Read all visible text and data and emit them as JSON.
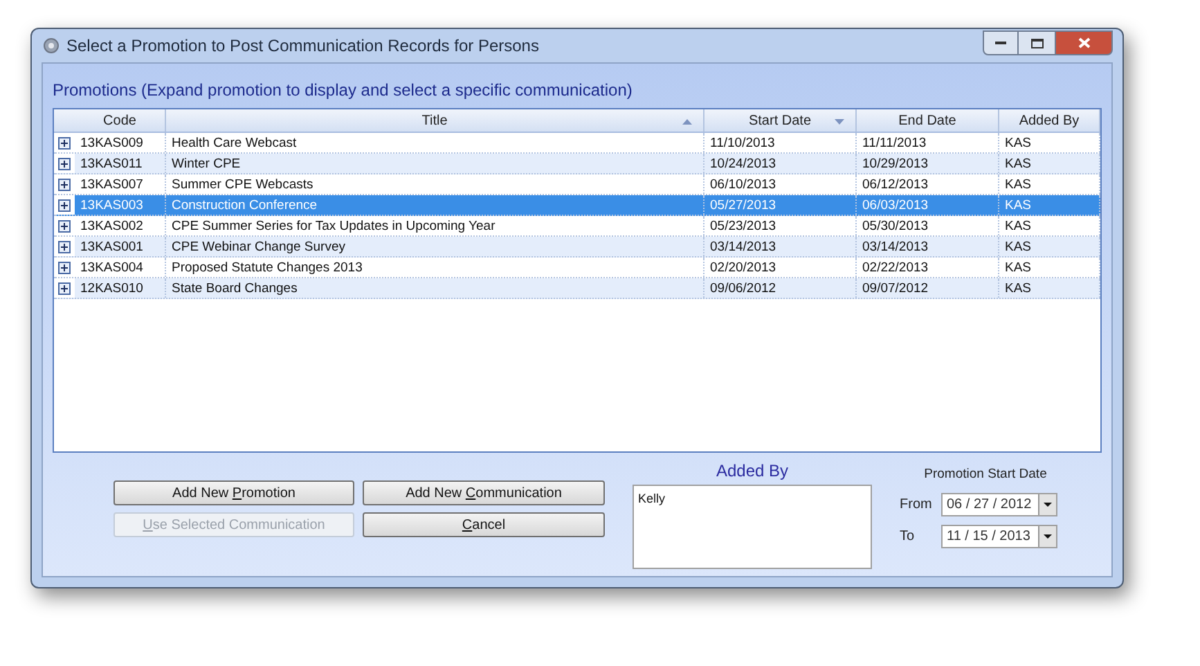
{
  "window": {
    "title": "Select a Promotion to Post Communication Records for Persons"
  },
  "promotions": {
    "heading": "Promotions (Expand promotion to display and select a specific communication)",
    "columns": [
      {
        "label": "Code",
        "sorted_ascending": false,
        "sorted_descending": false
      },
      {
        "label": "Title",
        "sorted_ascending": true,
        "sorted_descending": false
      },
      {
        "label": "Start Date",
        "sorted_ascending": false,
        "sorted_descending": true
      },
      {
        "label": "End Date",
        "sorted_ascending": false,
        "sorted_descending": false
      },
      {
        "label": "Added By",
        "sorted_ascending": false,
        "sorted_descending": false
      }
    ],
    "rows": [
      {
        "cells": [
          "13KAS009",
          "Health Care Webcast",
          "11/10/2013",
          "11/11/2013",
          "KAS"
        ],
        "selected": false,
        "expanded": false
      },
      {
        "cells": [
          "13KAS011",
          "Winter CPE",
          "10/24/2013",
          "10/29/2013",
          "KAS"
        ],
        "selected": false,
        "expanded": false
      },
      {
        "cells": [
          "13KAS007",
          "Summer CPE Webcasts",
          "06/10/2013",
          "06/12/2013",
          "KAS"
        ],
        "selected": false,
        "expanded": false
      },
      {
        "cells": [
          "13KAS003",
          "Construction Conference",
          "05/27/2013",
          "06/03/2013",
          "KAS"
        ],
        "selected": true,
        "expanded": false
      },
      {
        "cells": [
          "13KAS002",
          "CPE Summer Series for Tax Updates in Upcoming Year",
          "05/23/2013",
          "05/30/2013",
          "KAS"
        ],
        "selected": false,
        "expanded": false
      },
      {
        "cells": [
          "13KAS001",
          "CPE Webinar Change Survey",
          "03/14/2013",
          "03/14/2013",
          "KAS"
        ],
        "selected": false,
        "expanded": false
      },
      {
        "cells": [
          "13KAS004",
          "Proposed Statute Changes 2013",
          "02/20/2013",
          "02/22/2013",
          "KAS"
        ],
        "selected": false,
        "expanded": false
      },
      {
        "cells": [
          "12KAS010",
          "State Board Changes",
          "09/06/2012",
          "09/07/2012",
          "KAS"
        ],
        "selected": false,
        "expanded": false
      }
    ]
  },
  "buttons": [
    {
      "before": "Add New ",
      "key": "P",
      "after": "romotion",
      "disabled": false
    },
    {
      "before": "Add New ",
      "key": "C",
      "after": "ommunication",
      "disabled": false
    },
    {
      "key": "U",
      "after": "se Selected Communication",
      "disabled": true
    },
    {
      "key": "C",
      "after": "ancel",
      "disabled": false
    }
  ],
  "added_by": {
    "label": "Added By",
    "items": [
      "Kelly"
    ]
  },
  "date_range": {
    "label": "Promotion Start Date",
    "fields": [
      {
        "label": "From",
        "value": "06 / 27 / 2012"
      },
      {
        "label": "To",
        "value": "11 / 15 / 2013"
      }
    ]
  }
}
